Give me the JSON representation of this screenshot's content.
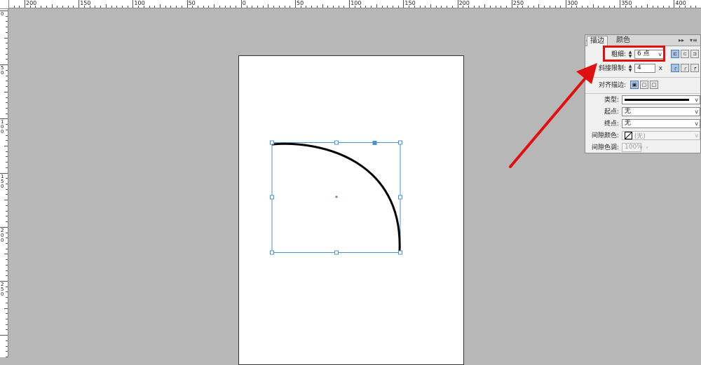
{
  "ruler": {
    "top_labels": [
      "200",
      "150",
      "100",
      "50",
      "0",
      "50",
      "100",
      "150",
      "200",
      "250",
      "300",
      "350",
      "400"
    ],
    "left_labels": [
      "0",
      "50",
      "100",
      "150",
      "200",
      "250"
    ]
  },
  "panel": {
    "tab_stroke": "描边",
    "tab_color": "颜色",
    "weight_label": "粗细:",
    "weight_value": "6 点",
    "miter_label": "斜接限制:",
    "miter_value": "4",
    "miter_unit": "x",
    "align_label": "对齐描边:",
    "type_label": "类型:",
    "start_label": "起点:",
    "start_value": "无",
    "end_label": "终点:",
    "end_value": "无",
    "gap_color_label": "间隙颜色:",
    "gap_color_value": "(无)",
    "gap_tint_label": "间隙色调:",
    "gap_tint_value": "100%"
  },
  "colors": {
    "highlight": "#e01010",
    "selection": "#4a90d9",
    "stroke": "#000000"
  }
}
